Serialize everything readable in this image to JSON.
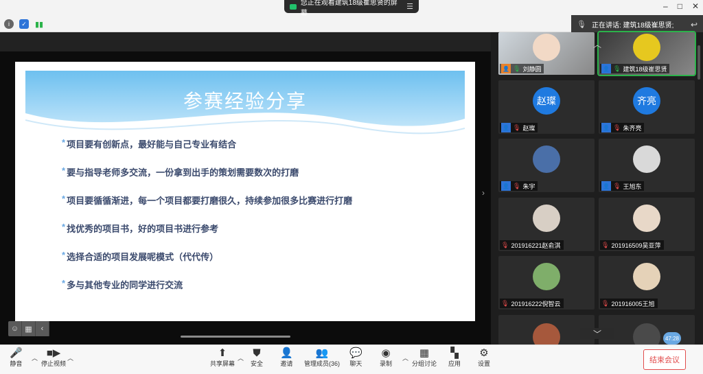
{
  "share_banner": {
    "text": "您正在观看建筑18级崔思贤的屏幕",
    "menu_icon": "menu-icon"
  },
  "window_controls": {
    "minimize": "–",
    "maximize": "□",
    "close": "✕"
  },
  "speaking": {
    "label": "正在讲话: 建筑18级崔思贤;"
  },
  "slide": {
    "title": "参赛经验分享",
    "bullets": [
      "项目要有创新点，最好能与自己专业有结合",
      "要与指导老师多交流，一份拿到出手的策划需要数次的打磨",
      "项目要循循渐进，每一个项目都要打磨很久，持续参加很多比赛进行打磨",
      "找优秀的项目书，好的项目书进行参考",
      "选择合适的项目发展呢模式（代代传）",
      "多与其他专业的同学进行交流"
    ],
    "bullet_marker": "*"
  },
  "participants": [
    {
      "name": "刘静圆",
      "type": "video",
      "role": "host-orange",
      "mic": "on",
      "color": "#cfd6dc"
    },
    {
      "name": "建筑18级崔思贤",
      "type": "video",
      "role": "host",
      "mic": "on",
      "active": true,
      "color": "#3a3a3a"
    },
    {
      "name": "赵璨",
      "type": "initials",
      "initials": "赵璨",
      "role": "host",
      "mic": "off",
      "color": "#1f7ae0"
    },
    {
      "name": "朱齐亮",
      "type": "initials",
      "initials": "齐亮",
      "role": "host",
      "mic": "off",
      "color": "#1f7ae0"
    },
    {
      "name": "朱宇",
      "type": "avatar",
      "role": "host",
      "mic": "off",
      "color": "#4a6fa8"
    },
    {
      "name": "王旭东",
      "type": "avatar",
      "role": "host",
      "mic": "off",
      "color": "#d9d9d9"
    },
    {
      "name": "201916221赵俞淇",
      "type": "avatar",
      "role": "",
      "mic": "off",
      "color": "#d8cfc5"
    },
    {
      "name": "201916509吴亚萍",
      "type": "avatar",
      "role": "",
      "mic": "off",
      "color": "#e8d8c8"
    },
    {
      "name": "201916222倪智云",
      "type": "avatar",
      "role": "",
      "mic": "off",
      "color": "#7fae6a"
    },
    {
      "name": "201916005王旭",
      "type": "avatar",
      "role": "",
      "mic": "off",
      "color": "#e5d2b8"
    },
    {
      "name": "",
      "type": "avatar",
      "role": "",
      "mic": "off",
      "color": "#a6583c"
    },
    {
      "name": "",
      "type": "avatar",
      "role": "",
      "mic": "off",
      "color": "#4a4a4a"
    }
  ],
  "timer": "47:28",
  "toolbar": {
    "mute": "静音",
    "stop_video": "停止视频",
    "share_screen": "共享屏幕",
    "security": "安全",
    "invite": "邀请",
    "manage_members": "管理成员(36)",
    "chat": "聊天",
    "record": "录制",
    "breakout": "分组讨论",
    "apps": "应用",
    "settings": "设置",
    "end_meeting": "结束会议"
  }
}
